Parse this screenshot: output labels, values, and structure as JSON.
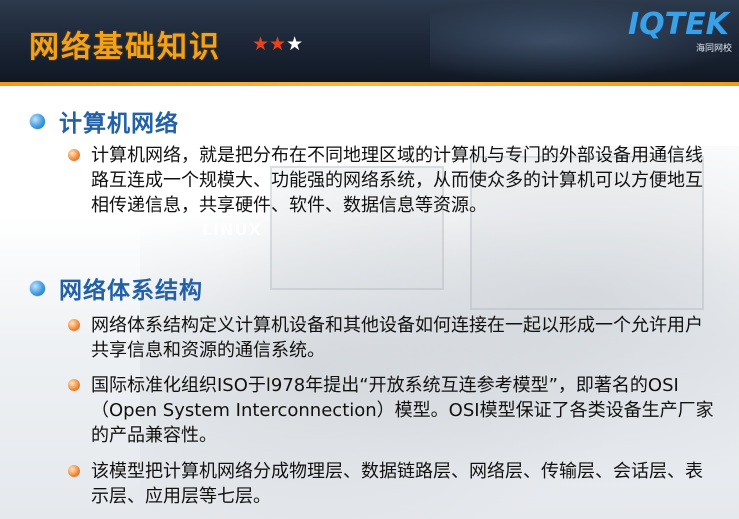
{
  "header": {
    "title": "网络基础知识",
    "stars": "★★★",
    "logo_text": "IQTEK",
    "logo_sub": "海同网校"
  },
  "colors": {
    "header_bg": "#1b2535",
    "title": "#f2a21a",
    "accent_line": "#f19a1d",
    "section_title": "#2260a8"
  },
  "background_ghost_text": "LINUX",
  "sections": [
    {
      "title": "计算机网络",
      "items": [
        "计算机网络，就是把分布在不同地理区域的计算机与专门的外部设备用通信线路互连成一个规模大、功能强的网络系统，从而使众多的计算机可以方便地互相传递信息，共享硬件、软件、数据信息等资源。"
      ]
    },
    {
      "title": "网络体系结构",
      "items": [
        "网络体系结构定义计算机设备和其他设备如何连接在一起以形成一个允许用户共享信息和资源的通信系统。",
        "国际标准化组织ISO于l978年提出“开放系统互连参考模型”，即著名的OSI（Open System Interconnection）模型。OSI模型保证了各类设备生产厂家的产品兼容性。",
        "该模型把计算机网络分成物理层、数据链路层、网络层、传输层、会话层、表示层、应用层等七层。"
      ]
    }
  ]
}
